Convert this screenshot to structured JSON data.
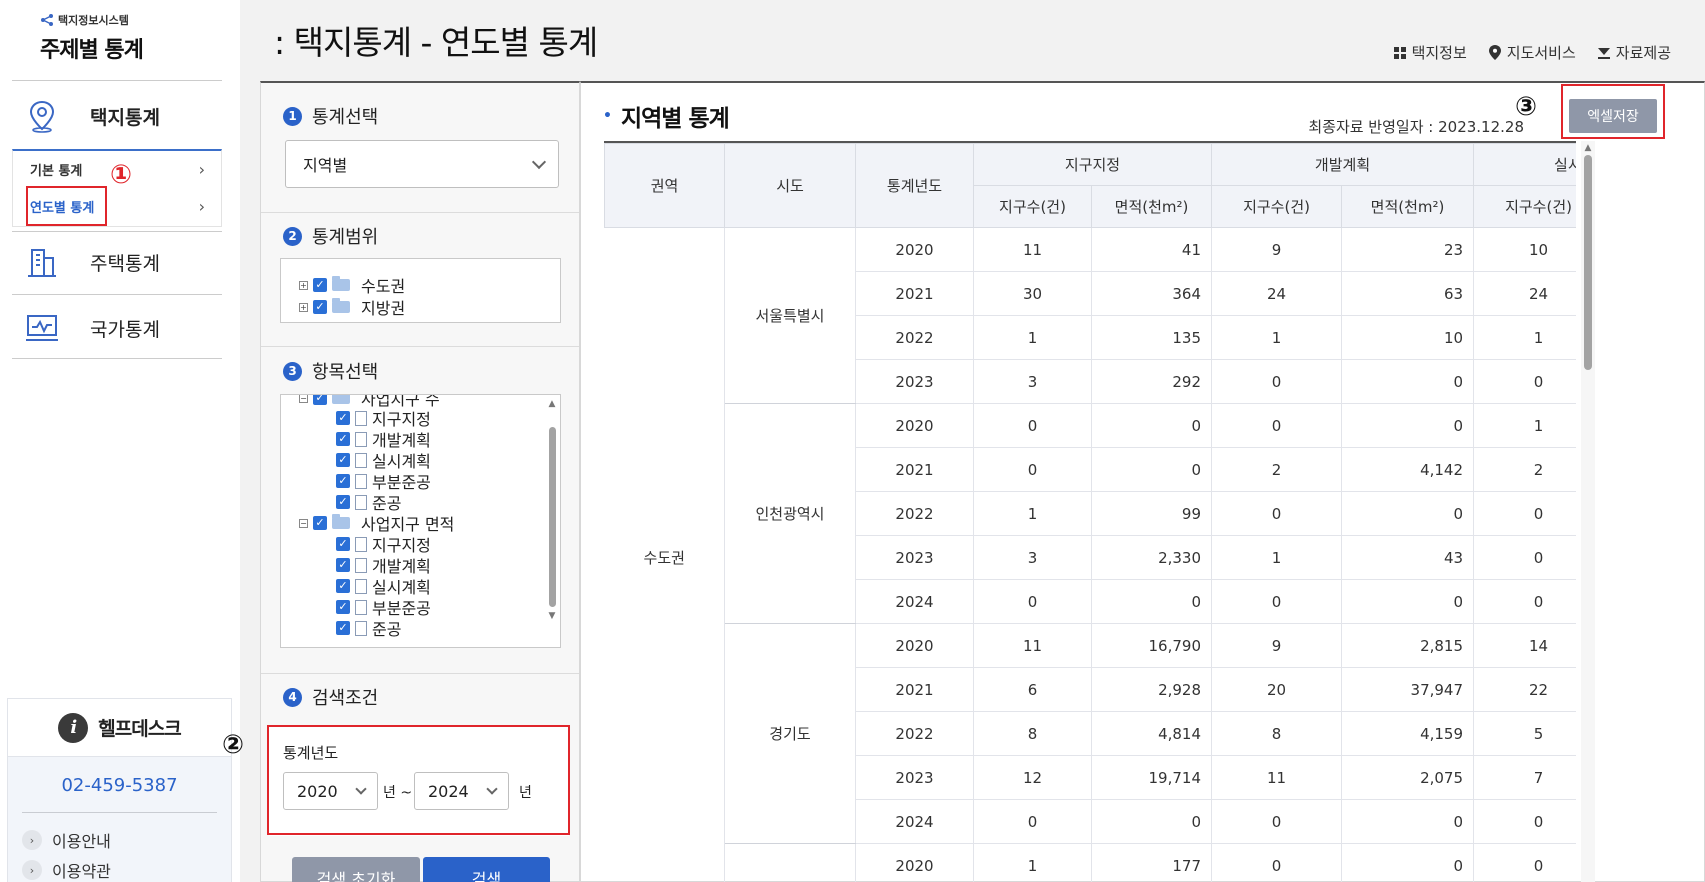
{
  "sidebar": {
    "system_name": "택지정보시스템",
    "section_title": "주제별 통계",
    "menu": [
      {
        "label": "택지통계",
        "icon": "map-pin-icon"
      },
      {
        "label": "주택통계",
        "icon": "building-icon"
      },
      {
        "label": "국가통계",
        "icon": "monitor-chart-icon"
      }
    ],
    "submenu": [
      {
        "label": "기본 통계"
      },
      {
        "label": "연도별 통계"
      }
    ],
    "help": {
      "title": "헬프데스크",
      "phone": "02-459-5387",
      "links": [
        "이용안내",
        "이용약관"
      ]
    }
  },
  "annotations": {
    "n1": "①",
    "n2": "②",
    "n3": "③"
  },
  "header": {
    "title": ": 택지통계 - 연도별 통계",
    "links": [
      {
        "label": "택지정보",
        "icon": "grid-icon"
      },
      {
        "label": "지도서비스",
        "icon": "location-pin-icon"
      },
      {
        "label": "자료제공",
        "icon": "download-icon"
      }
    ]
  },
  "filters": {
    "stat_select": {
      "num": "1",
      "title": "통계선택",
      "value": "지역별"
    },
    "stat_range": {
      "num": "2",
      "title": "통계범위",
      "items": [
        "수도권",
        "지방권"
      ]
    },
    "items": {
      "num": "3",
      "title": "항목선택",
      "partial_top": "사업지구 수",
      "group1_children": [
        "지구지정",
        "개발계획",
        "실시계획",
        "부분준공",
        "준공"
      ],
      "group2": "사업지구 면적",
      "group2_children": [
        "지구지정",
        "개발계획",
        "실시계획",
        "부분준공",
        "준공"
      ]
    },
    "search": {
      "num": "4",
      "title": "검색조건",
      "year_label": "통계년도",
      "from_year": "2020",
      "to_year": "2024",
      "unit_from": "년 ~",
      "unit_to": "년"
    },
    "buttons": {
      "reset": "검색 초기화",
      "search": "검색"
    }
  },
  "main": {
    "title": "지역별 통계",
    "update_text": "최종자료 반영일자 : 2023.12.28",
    "excel_button": "엑셀저장",
    "table": {
      "headers": {
        "region": "권역",
        "sido": "시도",
        "year": "통계년도",
        "groups": [
          "지구지정",
          "개발계획",
          "실시계획"
        ],
        "count": "지구수(건)",
        "area": "면적(천m²)",
        "area_short": "면적"
      },
      "region_name": "수도권",
      "sido": [
        {
          "name": "서울특별시",
          "rows": [
            [
              "2020",
              "11",
              "41",
              "9",
              "23",
              "10"
            ],
            [
              "2021",
              "30",
              "364",
              "24",
              "63",
              "24"
            ],
            [
              "2022",
              "1",
              "135",
              "1",
              "10",
              "1"
            ],
            [
              "2023",
              "3",
              "292",
              "0",
              "0",
              "0"
            ]
          ]
        },
        {
          "name": "인천광역시",
          "rows": [
            [
              "2020",
              "0",
              "0",
              "0",
              "0",
              "1"
            ],
            [
              "2021",
              "0",
              "0",
              "2",
              "4,142",
              "2"
            ],
            [
              "2022",
              "1",
              "99",
              "0",
              "0",
              "0"
            ],
            [
              "2023",
              "3",
              "2,330",
              "1",
              "43",
              "0"
            ],
            [
              "2024",
              "0",
              "0",
              "0",
              "0",
              "0"
            ]
          ]
        },
        {
          "name": "경기도",
          "rows": [
            [
              "2020",
              "11",
              "16,790",
              "9",
              "2,815",
              "14"
            ],
            [
              "2021",
              "6",
              "2,928",
              "20",
              "37,947",
              "22"
            ],
            [
              "2022",
              "8",
              "4,814",
              "8",
              "4,159",
              "5"
            ],
            [
              "2023",
              "12",
              "19,714",
              "11",
              "2,075",
              "7"
            ],
            [
              "2024",
              "0",
              "0",
              "0",
              "0",
              "0"
            ]
          ]
        }
      ],
      "next_row": [
        "2020",
        "1",
        "177",
        "0",
        "0",
        "0"
      ]
    }
  }
}
